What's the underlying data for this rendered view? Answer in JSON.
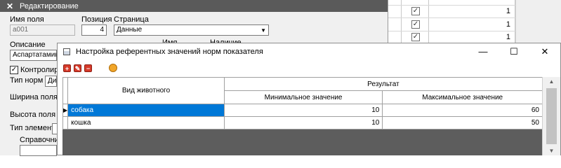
{
  "edit_window": {
    "title": "Редактирование",
    "field_name_label": "Имя поля",
    "field_name_value": "a001",
    "position_label": "Позиция",
    "position_value": "4",
    "page_label": "Страница",
    "page_value": "Данные",
    "description_label": "Описание",
    "description_value": "Аспартатаминот",
    "hidden_label_1": "Имя",
    "hidden_label_2": "Наличие",
    "controlled_label": "Контролирова",
    "controlled_checked": true,
    "norm_type_label": "Тип норм",
    "norm_type_value": "Диа",
    "field_width_label": "Ширина поля ввод",
    "field_height_label": "Высота поля ввод",
    "element_type_label": "Тип элемента",
    "reference_label": "Справочник"
  },
  "background_grid": {
    "rows": [
      {
        "checked": true,
        "value": "1"
      },
      {
        "checked": true,
        "value": "1"
      },
      {
        "checked": true,
        "value": "1"
      }
    ]
  },
  "dialog": {
    "title": "Настройка референтных значений норм показателя",
    "toolbar": {
      "add_icon": "plus-icon",
      "edit_icon": "edit-icon",
      "delete_icon": "minus-icon",
      "refresh_icon": "refresh-icon"
    },
    "grid": {
      "col_animal": "Вид животного",
      "col_result": "Результат",
      "col_min": "Минимальное значение",
      "col_max": "Максимальное значение",
      "rows": [
        {
          "animal": "собака",
          "min": "10",
          "max": "60"
        },
        {
          "animal": "кошка",
          "min": "10",
          "max": "50"
        }
      ]
    }
  },
  "colors": {
    "selection": "#0078d7",
    "title_bar_dark": "#5a5a5a",
    "grid_empty_area": "#5d5d5d",
    "toolbar_red": "#d63b2b",
    "toolbar_orange": "#f1a62a"
  }
}
